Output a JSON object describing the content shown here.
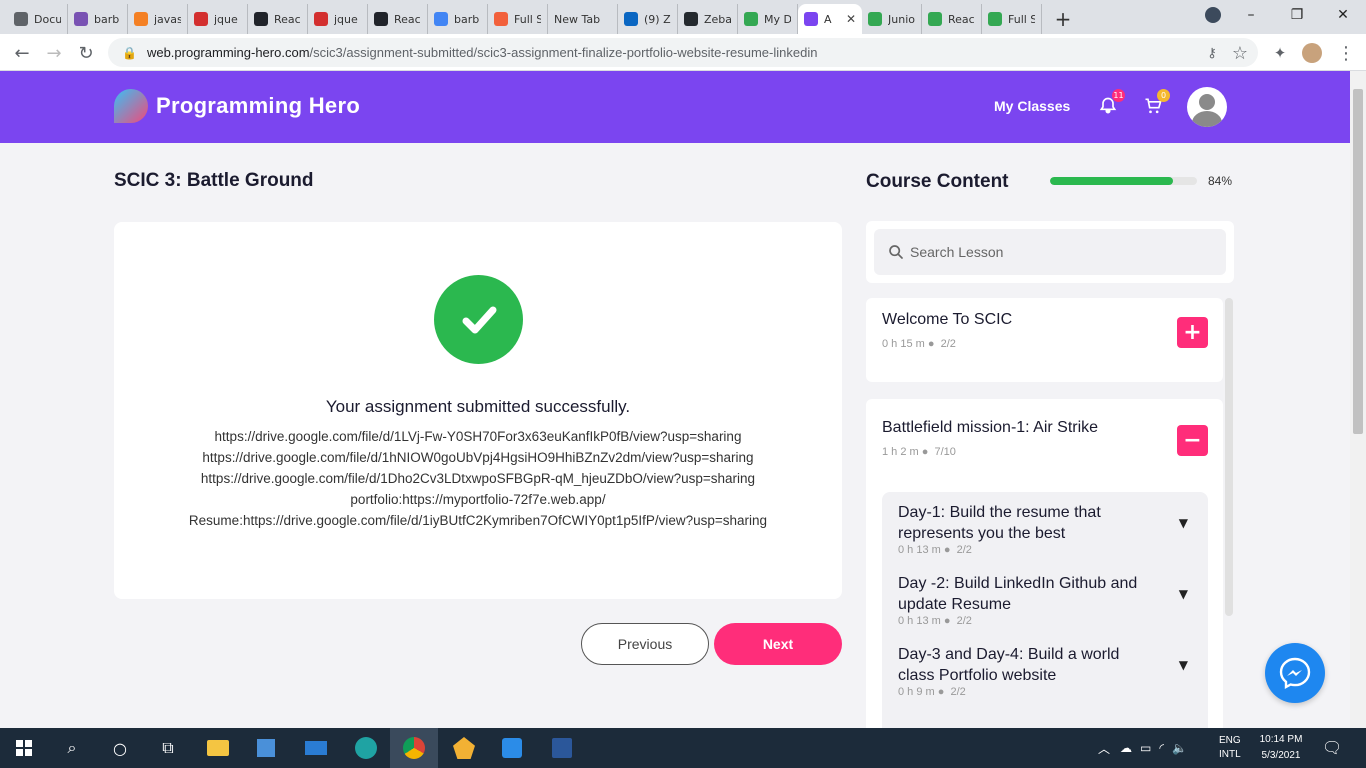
{
  "browser": {
    "tabs": [
      {
        "label": "Docu",
        "icon": "globe-icon",
        "color": "#5f6368"
      },
      {
        "label": "barb",
        "icon": "bootstrap-icon",
        "color": "#7952b3"
      },
      {
        "label": "javas",
        "icon": "stackoverflow-icon",
        "color": "#f48024"
      },
      {
        "label": "jque",
        "icon": "brand-icon",
        "color": "#d32f2f"
      },
      {
        "label": "Reac",
        "icon": "react-icon",
        "color": "#20232a"
      },
      {
        "label": "jque",
        "icon": "brand-icon",
        "color": "#d32f2f"
      },
      {
        "label": "Reac",
        "icon": "react-icon",
        "color": "#20232a"
      },
      {
        "label": "barb",
        "icon": "google-icon",
        "color": "#4285f4"
      },
      {
        "label": "Full S",
        "icon": "grammarly-icon",
        "color": "#f2603b"
      },
      {
        "label": "New Tab",
        "icon": "",
        "color": ""
      },
      {
        "label": "(9) Z",
        "icon": "linkedin-icon",
        "color": "#0a66c2"
      },
      {
        "label": "Zeba",
        "icon": "github-icon",
        "color": "#24292e"
      },
      {
        "label": "My D",
        "icon": "drive-icon",
        "color": "#34a853"
      },
      {
        "label": "A",
        "icon": "programming-hero-icon",
        "color": "#7b45f0",
        "active": true
      },
      {
        "label": "Junio",
        "icon": "drive-icon",
        "color": "#34a853"
      },
      {
        "label": "Reac",
        "icon": "drive-icon",
        "color": "#34a853"
      },
      {
        "label": "Full S",
        "icon": "drive-icon",
        "color": "#34a853"
      }
    ],
    "url_host": "web.programming-hero.com",
    "url_path": "/scic3/assignment-submitted/scic3-assignment-finalize-portfolio-website-resume-linkedin"
  },
  "header": {
    "logo_text": "Programming Hero",
    "my_classes": "My Classes",
    "notification_count": "11",
    "cart_count": "0"
  },
  "main": {
    "page_title": "SCIC 3: Battle Ground",
    "success_message": "Your assignment submitted successfully.",
    "links": [
      "https://drive.google.com/file/d/1LVj-Fw-Y0SH70For3x63euKanfIkP0fB/view?usp=sharing",
      "https://drive.google.com/file/d/1hNIOW0goUbVpj4HgsiHO9HhiBZnZv2dm/view?usp=sharing",
      "https://drive.google.com/file/d/1Dho2Cv3LDtxwpoSFBGpR-qM_hjeuZDbO/view?usp=sharing",
      "portfolio:https://myportfolio-72f7e.web.app/",
      "Resume:https://drive.google.com/file/d/1iyBUtfC2Kymriben7OfCWIY0pt1p5IfP/view?usp=sharing"
    ],
    "previous_label": "Previous",
    "next_label": "Next"
  },
  "sidebar": {
    "title": "Course Content",
    "progress_percent": 84,
    "progress_label": "84%",
    "search_placeholder": "Search Lesson",
    "modules": [
      {
        "title": "Welcome To SCIC",
        "duration": "0 h 15 m",
        "progress": "2/2",
        "expanded": false
      },
      {
        "title": "Battlefield mission-1: Air Strike",
        "duration": "1 h 2 m",
        "progress": "7/10",
        "expanded": true
      }
    ],
    "sub_items": [
      {
        "title": "Day-1: Build the resume that represents you the best",
        "duration": "0 h 13 m",
        "progress": "2/2"
      },
      {
        "title": "Day -2: Build LinkedIn Github and update Resume",
        "duration": "0 h 13 m",
        "progress": "2/2"
      },
      {
        "title": "Day-3 and Day-4: Build a world class Portfolio website",
        "duration": "0 h 9 m",
        "progress": "2/2"
      }
    ]
  },
  "taskbar": {
    "lang_1": "ENG",
    "lang_2": "INTL",
    "time": "10:14 PM",
    "date": "5/3/2021"
  },
  "colors": {
    "brand_purple": "#7b45f0",
    "accent_pink": "#ff2d7a",
    "success_green": "#2bb84f"
  }
}
